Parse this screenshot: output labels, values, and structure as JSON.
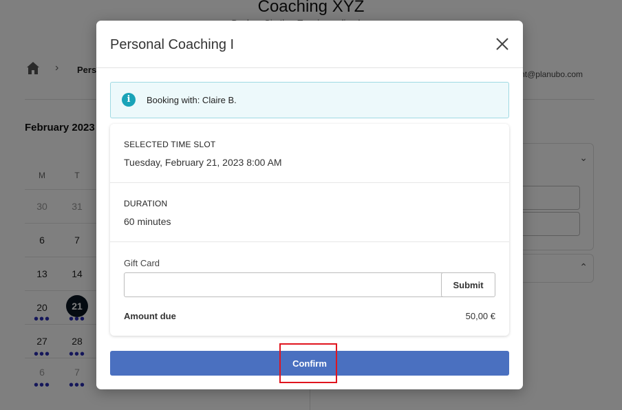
{
  "app": {
    "title": "Coaching XYZ",
    "subtitle": "Buchen Sie Ihre Termine online bequem"
  },
  "breadcrumb": {
    "home_icon": "home-icon",
    "current": "Perso"
  },
  "user": {
    "email_fragment": "nt@planubo.com"
  },
  "calendar": {
    "month": "February 2023",
    "weekday_headers": [
      "M",
      "T"
    ],
    "rows": [
      {
        "days": [
          "30",
          "31"
        ],
        "muted": true
      },
      {
        "days": [
          "6",
          "7"
        ]
      },
      {
        "days": [
          "13",
          "14"
        ]
      },
      {
        "days": [
          "20",
          "21"
        ],
        "selected": "21"
      },
      {
        "days": [
          "27",
          "28"
        ]
      },
      {
        "days": [
          "6",
          "7"
        ],
        "muted": true
      }
    ],
    "availability_dot": "•••"
  },
  "modal": {
    "title": "Personal Coaching I",
    "close_icon": "close-icon",
    "info": {
      "icon": "info-icon",
      "text": "Booking with: Claire B."
    },
    "time_slot": {
      "label": "SELECTED TIME SLOT",
      "value": "Tuesday, February 21, 2023 8:00 AM"
    },
    "duration": {
      "label": "DURATION",
      "value": "60 minutes"
    },
    "gift_card": {
      "label": "Gift Card",
      "value": "",
      "placeholder": "",
      "submit_label": "Submit"
    },
    "amount_due": {
      "label": "Amount due",
      "value": "50,00 €"
    },
    "confirm_label": "Confirm"
  },
  "colors": {
    "accent": "#4a70c0",
    "info_bg": "#edf9fb",
    "info_icon": "#1aa3b8",
    "highlight": "#e0141e",
    "selected_day": "#0b1622"
  }
}
